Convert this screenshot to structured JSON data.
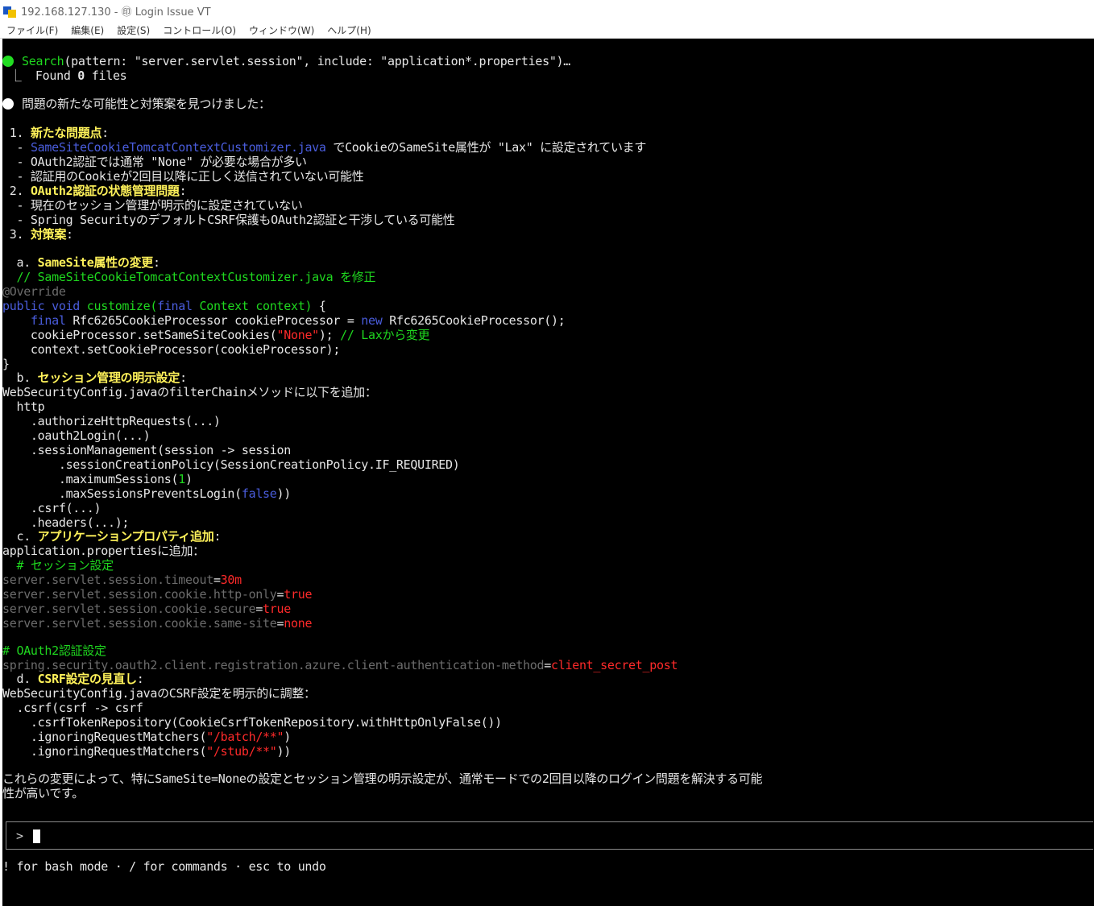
{
  "window": {
    "title": "192.168.127.130 - ㊞ Login Issue VT"
  },
  "menu": [
    "ファイル(F)",
    "編集(E)",
    "設定(S)",
    "コントロール(O)",
    "ウィンドウ(W)",
    "ヘルプ(H)"
  ],
  "terminal": {
    "tool": {
      "name": "Search",
      "args": "(pattern: \"server.servlet.session\", include: \"application*.properties\")…"
    },
    "result": {
      "prefix": " ⎿  Found ",
      "count": "0",
      "suffix": " files"
    },
    "heading": "問題の新たな可能性と対策案を見つけました：",
    "s1": {
      "num": " 1. ",
      "title": "新たな問題点",
      "b1_dash": "  - ",
      "b1_file": "SameSiteCookieTomcatContextCustomizer.java",
      "b1_text": " でCookieのSameSite属性が \"Lax\" に設定されています",
      "b2": "  - OAuth2認証では通常 \"None\" が必要な場合が多い",
      "b3": "  - 認証用のCookieが2回目以降に正しく送信されていない可能性"
    },
    "s2": {
      "num": " 2. ",
      "title": "OAuth2認証の状態管理問題",
      "b1": "  - 現在のセッション管理が明示的に設定されていない",
      "b2": "  - Spring SecurityのデフォルトCSRF保護もOAuth2認証と干渉している可能性"
    },
    "s3": {
      "num": " 3. ",
      "title": "対策案"
    },
    "a": {
      "label": "  a. ",
      "title": "SameSite属性の変更",
      "comment": "  // SameSiteCookieTomcatContextCustomizer.java を修正",
      "override": "@Override",
      "kw_public": "public void",
      "fn_customize": " customize(",
      "kw_final": "final",
      "ctx_type": " Context context)",
      "brace_open": " {",
      "l2_indent": "    ",
      "l2_final": "final",
      "l2_mid": " Rfc6265CookieProcessor cookieProcessor = ",
      "l2_new": "new",
      "l2_end": " Rfc6265CookieProcessor();",
      "l3_a": "    cookieProcessor.setSameSiteCookies(",
      "l3_str": "\"None\"",
      "l3_b": "); ",
      "l3_comment": "// Laxから変更",
      "l4": "    context.setCookieProcessor(cookieProcessor);",
      "brace_close": "}"
    },
    "b": {
      "label": "  b. ",
      "title": "セッション管理の明示設定",
      "intro": "WebSecurityConfig.javaのfilterChainメソッドに以下を追加：",
      "l1": "  http",
      "l2": "    .authorizeHttpRequests(...)",
      "l3": "    .oauth2Login(...)",
      "l4": "    .sessionManagement(session -> session",
      "l5": "        .sessionCreationPolicy(SessionCreationPolicy.IF_REQUIRED)",
      "l6_a": "        .maximumSessions(",
      "l6_num": "1",
      "l6_b": ")",
      "l7_a": "        .maxSessionsPreventsLogin(",
      "l7_kw": "false",
      "l7_b": "))",
      "l8": "    .csrf(...)",
      "l9": "    .headers(...);"
    },
    "c": {
      "label": "  c. ",
      "title": "アプリケーションプロパティ追加",
      "intro": "application.propertiesに追加：",
      "comment1": "  # セッション設定",
      "p1_key": "server.servlet.session.timeout",
      "p1_val": "30m",
      "p2_key": "server.servlet.session.cookie.http-only",
      "p2_val": "true",
      "p3_key": "server.servlet.session.cookie.secure",
      "p3_val": "true",
      "p4_key": "server.servlet.session.cookie.same-site",
      "p4_val": "none",
      "comment2": "# OAuth2認証設定",
      "p5_key": "spring.security.oauth2.client.registration.azure.client-authentication-method",
      "p5_val": "client_secret_post",
      "eq": "="
    },
    "d": {
      "label": "  d. ",
      "title": "CSRF設定の見直し",
      "intro": "WebSecurityConfig.javaのCSRF設定を明示的に調整：",
      "l1": "  .csrf(csrf -> csrf",
      "l2": "    .csrfTokenRepository(CookieCsrfTokenRepository.withHttpOnlyFalse())",
      "l3_a": "    .ignoringRequestMatchers(",
      "l3_str": "\"/batch/**\"",
      "l3_b": ")",
      "l4_a": "    .ignoringRequestMatchers(",
      "l4_str": "\"/stub/**\"",
      "l4_b": "))"
    },
    "conclusion1": "これらの変更によって、特にSameSite=Noneの設定とセッション管理の明示設定が、通常モードでの2回目以降のログイン問題を解決する可能",
    "conclusion2": "性が高いです。",
    "prompt": ">",
    "hint": "! for bash mode · / for commands · esc to undo"
  },
  "colors": {
    "background": "#000000",
    "heading_yellow": "#fff25a",
    "green": "#1fd81f",
    "blue": "#4a5ddd",
    "dim": "#6c6c6c",
    "red": "#ff2a2a"
  }
}
